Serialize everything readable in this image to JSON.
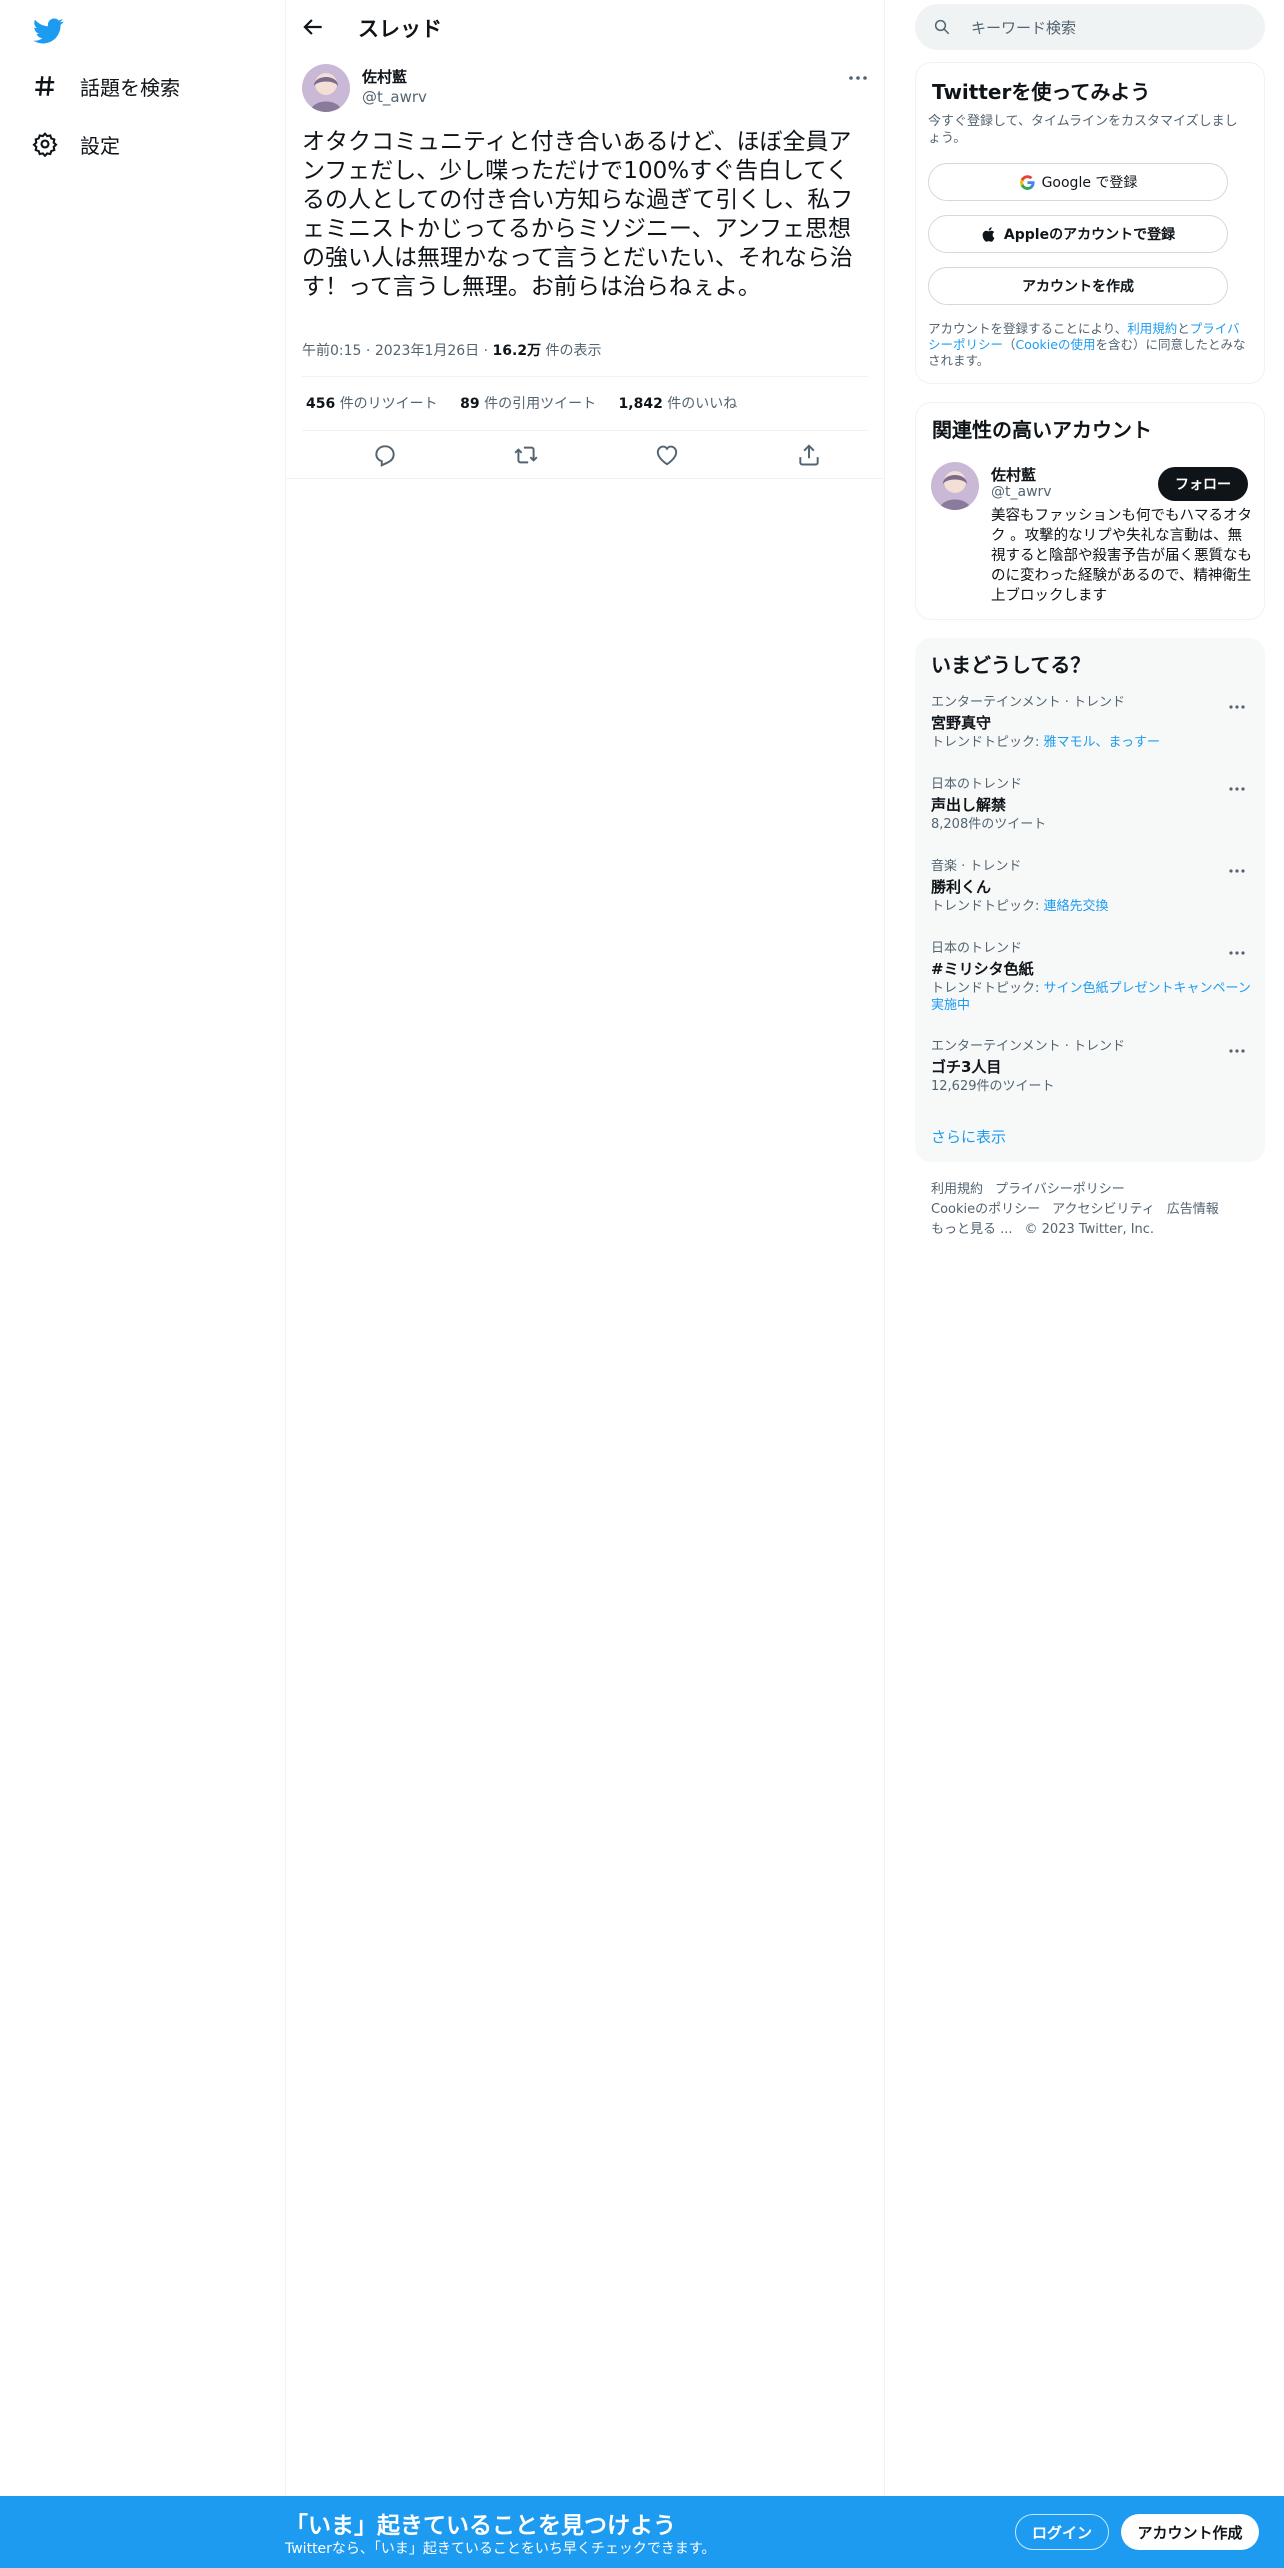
{
  "colors": {
    "accent": "#1d9bf0",
    "text": "#0f1419",
    "muted": "#536471",
    "border": "#eff3f4"
  },
  "sidebar": {
    "items": [
      {
        "icon": "hashtag-icon",
        "label": "話題を検索"
      },
      {
        "icon": "gear-icon",
        "label": "設定"
      }
    ]
  },
  "header": {
    "title": "スレッド"
  },
  "tweet": {
    "display_name": "佐村藍",
    "handle": "@t_awrv",
    "text": "オタクコミュニティと付き合いあるけど、ほぼ全員アンフェだし、少し喋っただけで100%すぐ告白してくるの人としての付き合い方知らな過ぎて引くし、私フェミニストかじってるからミソジニー、アンフェ思想の強い人は無理かなって言うとだいたい、それなら治す！って言うし無理。お前らは治らねぇよ。",
    "time": "午前0:15",
    "date": "2023年1月26日",
    "views_count": "16.2万",
    "views_label": "件の表示",
    "sep": "·",
    "retweets_count": "456",
    "retweets_label": "件のリツイート",
    "quotes_count": "89",
    "quotes_label": "件の引用ツイート",
    "likes_count": "1,842",
    "likes_label": "件のいいね"
  },
  "search": {
    "placeholder": "キーワード検索"
  },
  "signup_card": {
    "title": "Twitterを使ってみよう",
    "subtitle": "今すぐ登録して、タイムラインをカスタマイズしましょう。",
    "google_label": "Google で登録",
    "apple_label": "Appleのアカウントで登録",
    "create_label": "アカウントを作成",
    "legal_prefix": "アカウントを登録することにより、",
    "terms": "利用規約",
    "and": "と",
    "privacy": "プライバシーポリシー",
    "paren_open": "（",
    "cookie": "Cookieの使用",
    "legal_suffix": "を含む）に同意したとみなされます。"
  },
  "related": {
    "title": "関連性の高いアカウント",
    "name": "佐村藍",
    "handle": "@t_awrv",
    "follow_label": "フォロー",
    "bio": "美容もファッションも何でもハマるオタク 。攻撃的なリプや失礼な言動は、無視すると陰部や殺害予告が届く悪質なものに変わった経験があるので、精神衛生上ブロックします"
  },
  "trends": {
    "title": "いまどうしてる？",
    "items": [
      {
        "category": "エンターテインメント · トレンド",
        "name": "宮野真守",
        "prefix": "トレンドトピック: ",
        "link": "雅マモル、まっすー",
        "meta": ""
      },
      {
        "category": "日本のトレンド",
        "name": "声出し解禁",
        "prefix": "",
        "link": "",
        "meta": "8,208件のツイート"
      },
      {
        "category": "音楽 · トレンド",
        "name": "勝利くん",
        "prefix": "トレンドトピック: ",
        "link": "連絡先交換",
        "meta": ""
      },
      {
        "category": "日本のトレンド",
        "name": "#ミリシタ色紙",
        "prefix": "トレンドトピック: ",
        "link": "サイン色紙プレゼントキャンペーン実施中",
        "meta": ""
      },
      {
        "category": "エンターテインメント · トレンド",
        "name": "ゴチ3人目",
        "prefix": "",
        "link": "",
        "meta": "12,629件のツイート"
      }
    ],
    "show_more": "さらに表示"
  },
  "footer": {
    "terms": "利用規約",
    "privacy": "プライバシーポリシー",
    "cookie": "Cookieのポリシー",
    "accessibility": "アクセシビリティ",
    "ads": "広告情報",
    "more": "もっと見る ...",
    "copyright": "© 2023 Twitter, Inc."
  },
  "banner": {
    "title": "「いま」起きていることを見つけよう",
    "subtitle": "Twitterなら、「いま」起きていることをいち早くチェックできます。",
    "login": "ログイン",
    "signup": "アカウント作成"
  }
}
